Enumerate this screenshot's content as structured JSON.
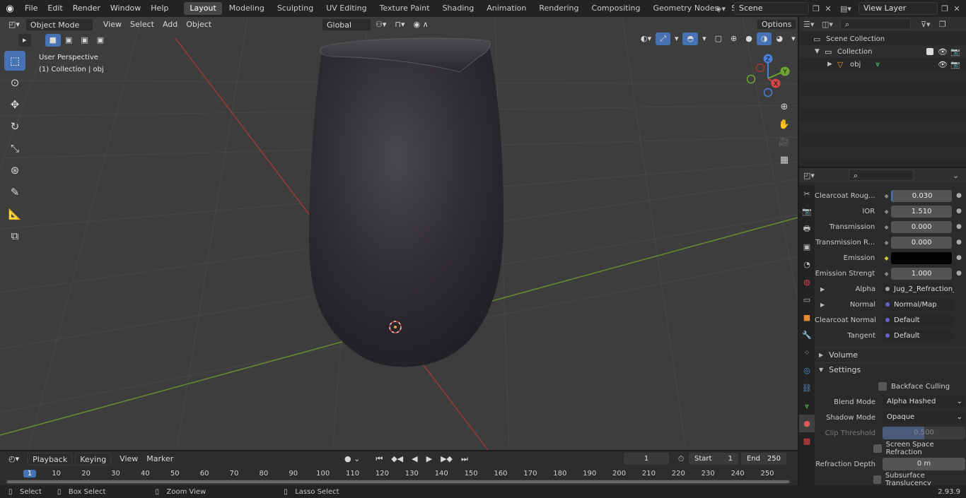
{
  "topbar": {
    "menus": [
      "File",
      "Edit",
      "Render",
      "Window",
      "Help"
    ],
    "workspaces": [
      "Layout",
      "Modeling",
      "Sculpting",
      "UV Editing",
      "Texture Paint",
      "Shading",
      "Animation",
      "Rendering",
      "Compositing",
      "Geometry Nodes",
      "Scripting"
    ],
    "active_workspace": "Layout",
    "add_tab": "+",
    "scene": "Scene",
    "view_layer": "View Layer"
  },
  "viewport": {
    "mode": "Object Mode",
    "menus": [
      "View",
      "Select",
      "Add",
      "Object"
    ],
    "transform": "Global",
    "options": "Options",
    "overlay_title": "User Perspective",
    "overlay_subtitle": "(1) Collection | obj",
    "gizmo_axes": {
      "z": "Z",
      "y": "Y",
      "x": "X"
    }
  },
  "outliner": {
    "items": [
      {
        "label": "Scene Collection"
      },
      {
        "label": "Collection"
      },
      {
        "label": "obj"
      }
    ]
  },
  "properties": {
    "rows": [
      {
        "label": "Clearcoat Roug...",
        "value": "0.030",
        "kind": "num"
      },
      {
        "label": "IOR",
        "value": "1.510",
        "kind": "num"
      },
      {
        "label": "Transmission",
        "value": "0.000",
        "kind": "num"
      },
      {
        "label": "Transmission R...",
        "value": "0.000",
        "kind": "num"
      },
      {
        "label": "Emission",
        "value": "",
        "kind": "color"
      },
      {
        "label": "Emission Strengt",
        "value": "1.000",
        "kind": "num"
      },
      {
        "label": "Alpha",
        "value": "Jug_2_Refraction_in...",
        "kind": "link"
      },
      {
        "label": "Normal",
        "value": "Normal/Map",
        "kind": "link"
      },
      {
        "label": "Clearcoat Normal",
        "value": "Default",
        "kind": "link"
      },
      {
        "label": "Tangent",
        "value": "Default",
        "kind": "link"
      }
    ],
    "sections": {
      "volume": "Volume",
      "settings": "Settings"
    },
    "settings": {
      "backface_culling": "Backface Culling",
      "blend_mode_label": "Blend Mode",
      "blend_mode": "Alpha Hashed",
      "shadow_mode_label": "Shadow Mode",
      "shadow_mode": "Opaque",
      "clip_threshold_label": "Clip Threshold",
      "clip_threshold": "0.500",
      "ssr": "Screen Space Refraction",
      "refraction_depth_label": "Refraction Depth",
      "refraction_depth": "0 m",
      "subsurface": "Subsurface Translucency"
    },
    "colors": {
      "emission": "#000000",
      "accent": "#4772b3"
    }
  },
  "timeline": {
    "menus": [
      "Playback",
      "Keying",
      "View",
      "Marker"
    ],
    "current_frame": "1",
    "start_label": "Start",
    "start": "1",
    "end_label": "End",
    "end": "250",
    "ticks": [
      "1",
      "10",
      "20",
      "30",
      "40",
      "50",
      "60",
      "70",
      "80",
      "90",
      "100",
      "110",
      "120",
      "130",
      "140",
      "150",
      "160",
      "170",
      "180",
      "190",
      "200",
      "210",
      "220",
      "230",
      "240",
      "250"
    ]
  },
  "statusbar": {
    "select": "Select",
    "box_select": "Box Select",
    "zoom_view": "Zoom View",
    "lasso_select": "Lasso Select",
    "version": "2.93.9"
  }
}
